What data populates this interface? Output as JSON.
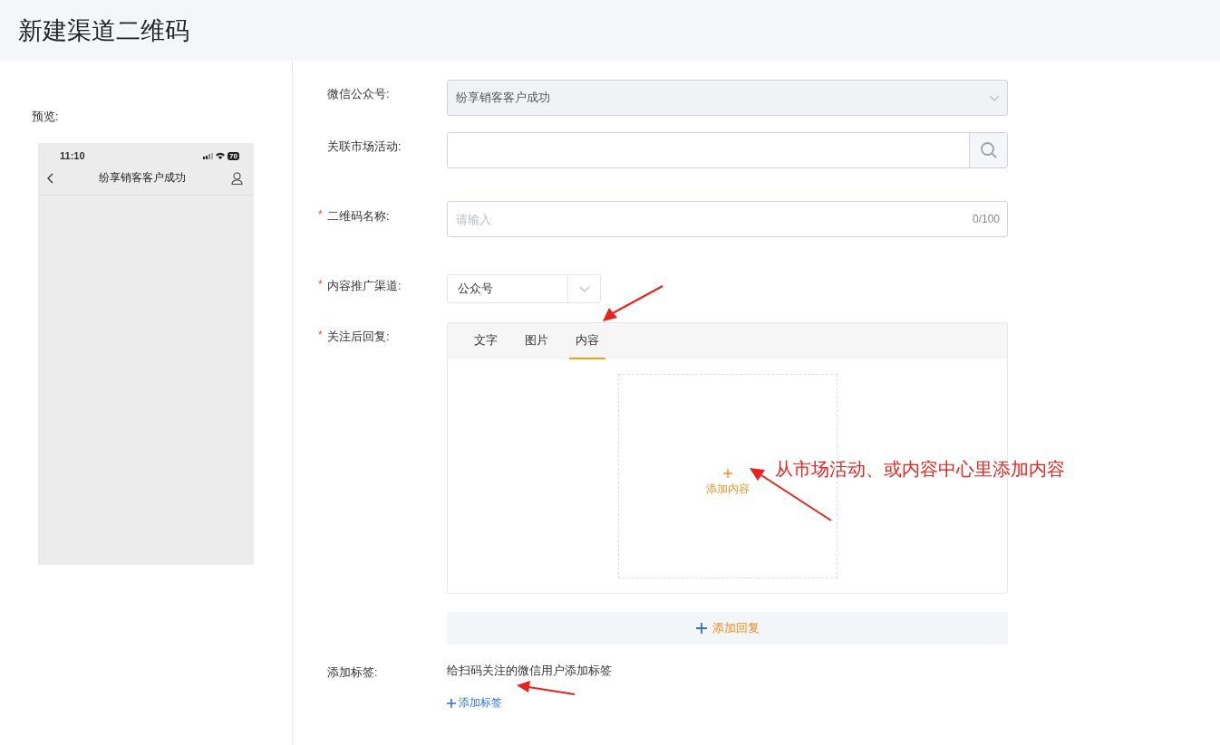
{
  "page_title": "新建渠道二维码",
  "preview": {
    "label": "预览:",
    "time": "11:10",
    "battery": "70",
    "title": "纷享销客客户成功"
  },
  "form": [
    {
      "kind": "select",
      "label": "微信公众号:",
      "value": "纷享销客客户成功",
      "disabled": true
    },
    {
      "kind": "search",
      "label": "关联市场活动:"
    },
    {
      "kind": "text",
      "label": "二维码名称:",
      "required_mark": "*",
      "placeholder": "请输入",
      "counter": "0/100"
    },
    {
      "kind": "dropdown",
      "label": "内容推广渠道:",
      "required_mark": "*",
      "value": "公众号"
    },
    {
      "kind": "reply",
      "label": "关注后回复:",
      "required_mark": "*",
      "tabs": [
        {
          "label": "文字",
          "selected": false
        },
        {
          "label": "图片",
          "selected": false
        },
        {
          "label": "内容",
          "selected": true
        }
      ],
      "add_content": "添加内容",
      "add_reply": "添加回复"
    },
    {
      "kind": "tags",
      "label": "添加标签:",
      "hint": "给扫码关注的微信用户添加标签",
      "add_tag": "添加标签"
    }
  ],
  "annotation": {
    "text": "从市场活动、或内容中心里添加内容"
  }
}
